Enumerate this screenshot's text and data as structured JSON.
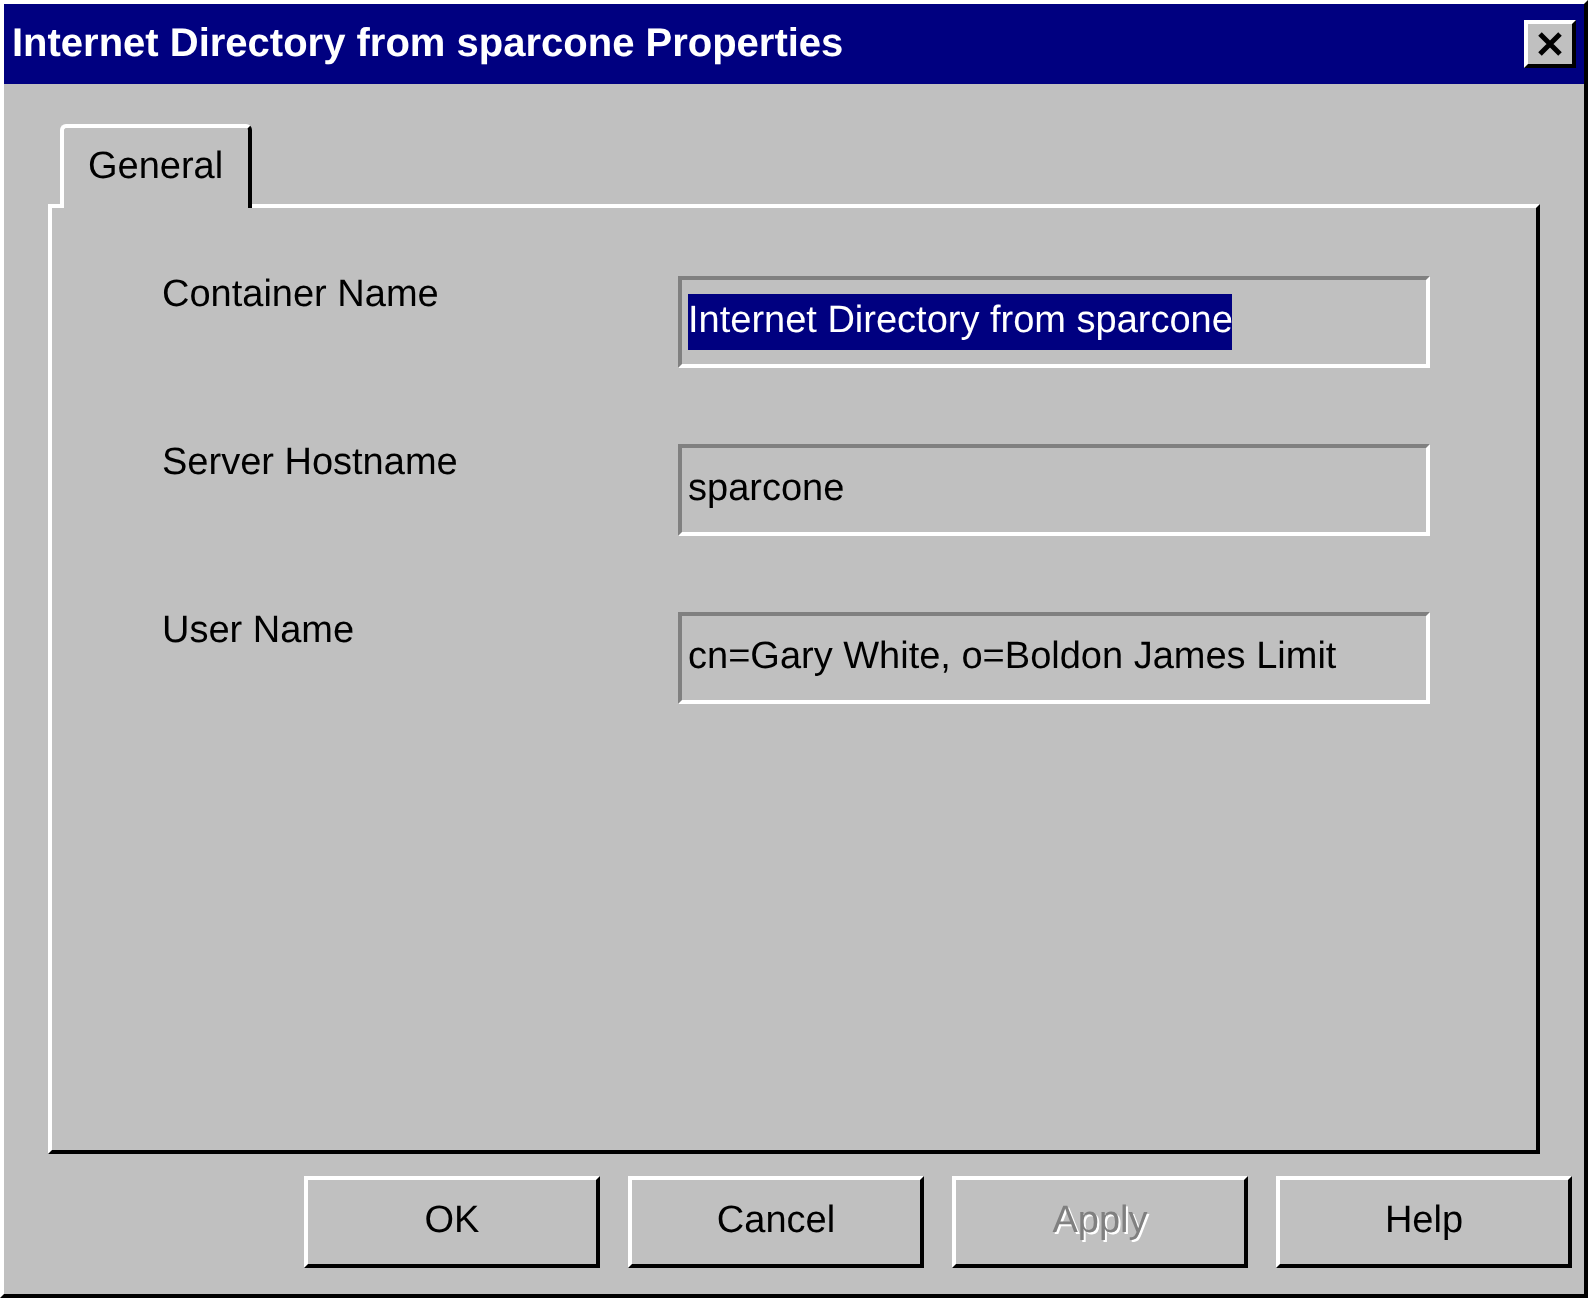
{
  "window": {
    "title": "Internet Directory from sparcone Properties"
  },
  "tabs": [
    {
      "label": "General",
      "selected": true
    }
  ],
  "fields": [
    {
      "label": "Container Name",
      "value": "Internet Directory from sparcone",
      "value_selected": true
    },
    {
      "label": "Server Hostname",
      "value": "sparcone",
      "value_selected": false
    },
    {
      "label": "User Name",
      "value": "cn=Gary White, o=Boldon James Limit",
      "value_selected": false
    }
  ],
  "buttons": [
    {
      "label": "OK",
      "disabled": false
    },
    {
      "label": "Cancel",
      "disabled": false
    },
    {
      "label": "Apply",
      "disabled": true
    },
    {
      "label": "Help",
      "disabled": false
    }
  ]
}
